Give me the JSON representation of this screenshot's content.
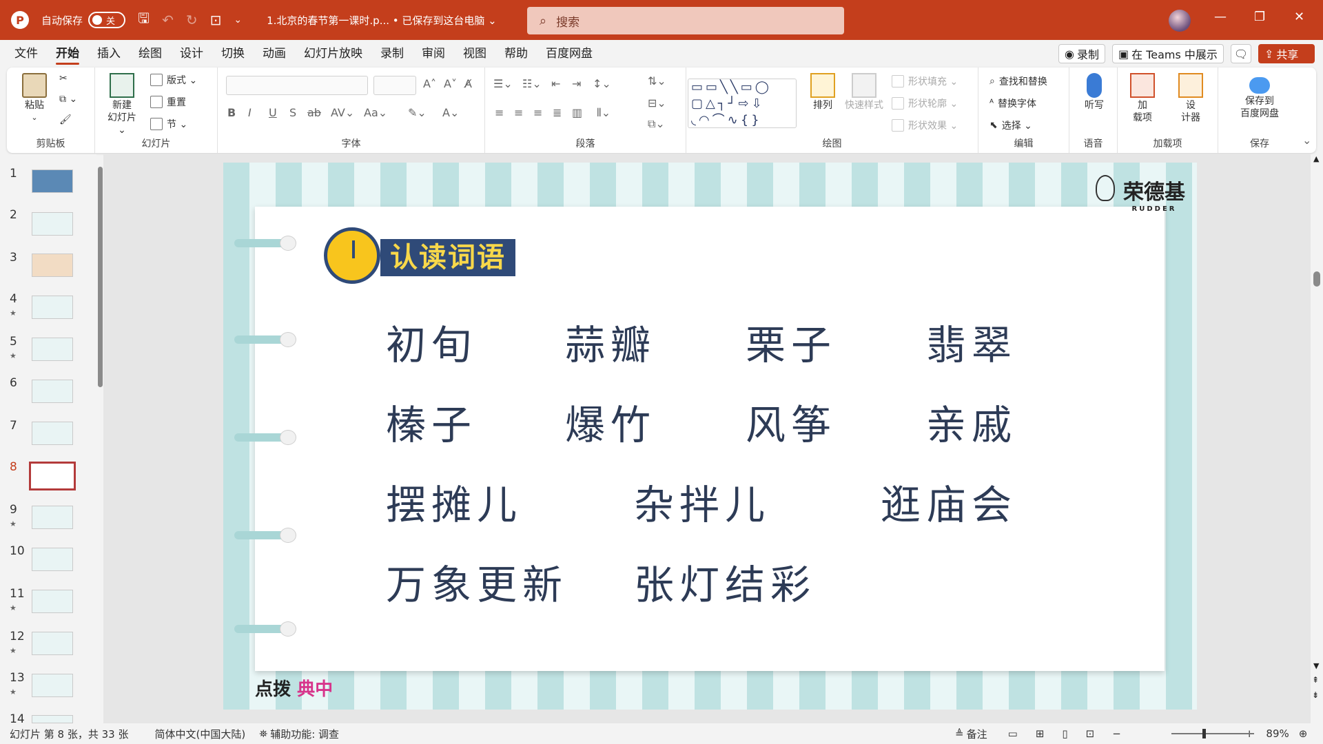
{
  "titlebar": {
    "autosave_label": "自动保存",
    "autosave_state": "关",
    "doc_title": "1.北京的春节第一课时.p...  • 已保存到这台电脑 ⌄",
    "search_placeholder": "搜索"
  },
  "menu": {
    "items": [
      "文件",
      "开始",
      "插入",
      "绘图",
      "设计",
      "切换",
      "动画",
      "幻灯片放映",
      "录制",
      "审阅",
      "视图",
      "帮助",
      "百度网盘"
    ],
    "active": "开始",
    "record_label": "录制",
    "teams_label": "在 Teams 中展示",
    "share_label": "共享"
  },
  "ribbon": {
    "clipboard": {
      "label": "剪贴板",
      "paste": "粘贴"
    },
    "slides": {
      "label": "幻灯片",
      "new_slide_1": "新建",
      "new_slide_2": "幻灯片 ⌄",
      "layout": "版式 ⌄",
      "reset": "重置",
      "section": "节 ⌄"
    },
    "font": {
      "label": "字体"
    },
    "paragraph": {
      "label": "段落"
    },
    "drawing": {
      "label": "绘图",
      "arrange": "排列",
      "quick_styles": "快速样式",
      "fill": "形状填充 ⌄",
      "outline": "形状轮廓 ⌄",
      "effects": "形状效果 ⌄"
    },
    "editing": {
      "label": "编辑",
      "find_replace": "查找和替换",
      "replace_font": "替换字体",
      "select": "选择 ⌄"
    },
    "voice": {
      "label": "语音",
      "dictate": "听写"
    },
    "addins": {
      "label": "加载项",
      "addins_1": "加",
      "addins_2": "载项",
      "designer_1": "设",
      "designer_2": "计器"
    },
    "baidu": {
      "save_1": "保存到",
      "save_2": "百度网盘",
      "save_3": "保存"
    }
  },
  "thumbnails": {
    "numbers": [
      "1",
      "2",
      "3",
      "4",
      "5",
      "6",
      "7",
      "8",
      "9",
      "10",
      "11",
      "12",
      "13",
      "14"
    ],
    "selected": "8"
  },
  "slide": {
    "brand": "荣德基",
    "brand_sub": "RUDDER",
    "section_title": "认读词语",
    "words_row1": [
      "初旬",
      "蒜瓣",
      "栗子",
      "翡翠"
    ],
    "words_row2": [
      "榛子",
      "爆竹",
      "风筝",
      "亲戚"
    ],
    "words_row3": [
      "摆摊儿",
      "杂拌儿",
      "逛庙会"
    ],
    "words_row4": [
      "万象更新",
      "张灯结彩"
    ],
    "footer_logo_a": "点拨",
    "footer_logo_b": "典中"
  },
  "status": {
    "slide_count": "幻灯片 第 8 张，共 33 张",
    "language": "简体中文(中国大陆)",
    "accessibility": "辅助功能: 调查",
    "notes": "备注",
    "zoom": "89%"
  },
  "colors": {
    "accent": "#c43e1c",
    "slide_title_bg": "#2f4a78",
    "word_text": "#2d3b56"
  }
}
